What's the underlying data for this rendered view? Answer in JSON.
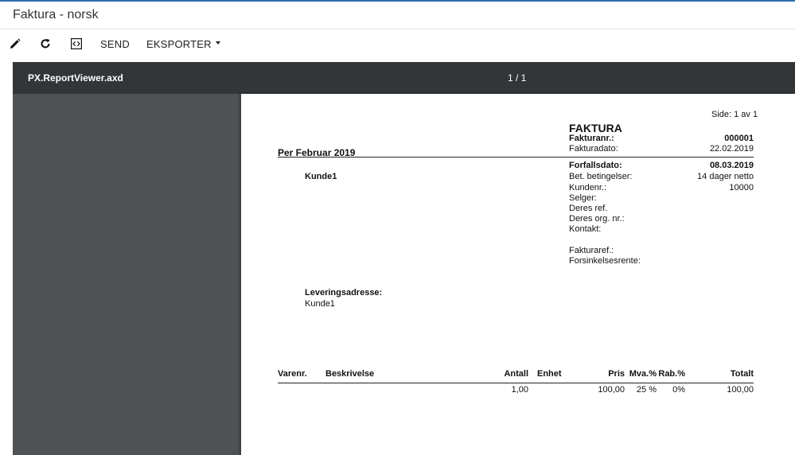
{
  "window": {
    "title": "Faktura - norsk"
  },
  "toolbar": {
    "edit_icon": "pencil-icon",
    "refresh_icon": "refresh-icon",
    "code_icon": "code-icon",
    "send_label": "SEND",
    "export_label": "EKSPORTER"
  },
  "viewer": {
    "file_name": "PX.ReportViewer.axd",
    "page_indicator": "1 / 1"
  },
  "report": {
    "page_label": "Side: 1 av 1",
    "doc_title": "FAKTURA",
    "period": "Per Februar 2019",
    "customer_name": "Kunde1",
    "fields": {
      "invoice_no_label": "Fakturanr.:",
      "invoice_no": "000001",
      "invoice_date_label": "Fakturadato:",
      "invoice_date": "22.02.2019",
      "due_date_label": "Forfallsdato:",
      "due_date": "08.03.2019",
      "terms_label": "Bet. betingelser:",
      "terms": "14 dager netto",
      "customer_no_label": "Kundenr.:",
      "customer_no": "10000",
      "seller_label": "Selger:",
      "your_ref_label": "Deres ref.",
      "your_org_label": "Deres org. nr.:",
      "contact_label": "Kontakt:",
      "invoice_ref_label": "Fakturaref.:",
      "late_interest_label": "Forsinkelsesrente:"
    },
    "delivery": {
      "label": "Leveringsadresse:",
      "name": "Kunde1"
    },
    "table": {
      "headers": {
        "item_no": "Varenr.",
        "description": "Beskrivelse",
        "qty": "Antall",
        "unit": "Enhet",
        "price": "Pris",
        "vat": "Mva.%",
        "discount": "Rab.%",
        "total": "Totalt"
      },
      "rows": [
        {
          "qty": "1,00",
          "price": "100,00",
          "vat": "25 %",
          "discount": "0%",
          "total": "100,00"
        }
      ]
    }
  }
}
